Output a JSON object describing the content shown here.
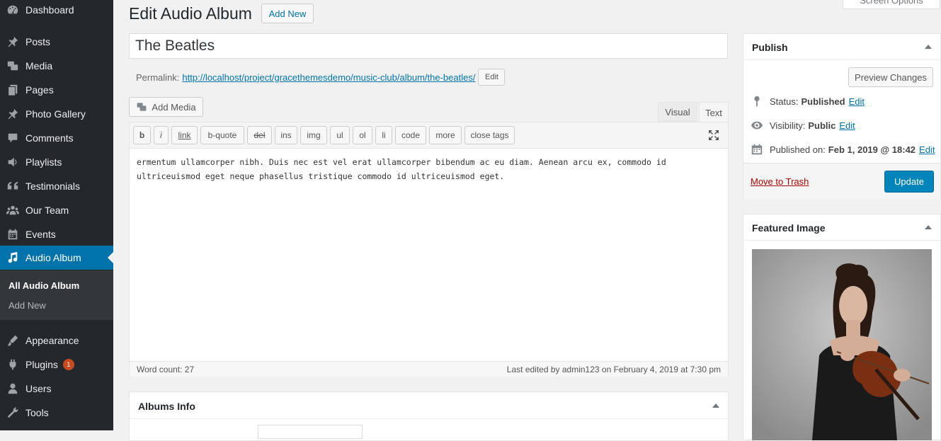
{
  "sidebar": {
    "items": [
      {
        "label": "Dashboard",
        "icon": "dashboard-icon"
      },
      {
        "label": "Posts",
        "icon": "pin-icon"
      },
      {
        "label": "Media",
        "icon": "media-icon"
      },
      {
        "label": "Pages",
        "icon": "pages-icon"
      },
      {
        "label": "Photo Gallery",
        "icon": "pin-icon"
      },
      {
        "label": "Comments",
        "icon": "comment-icon"
      },
      {
        "label": "Playlists",
        "icon": "speaker-icon"
      },
      {
        "label": "Testimonials",
        "icon": "quote-icon"
      },
      {
        "label": "Our Team",
        "icon": "team-icon"
      },
      {
        "label": "Events",
        "icon": "calendar-icon"
      },
      {
        "label": "Audio Album",
        "icon": "music-icon"
      },
      {
        "label": "Appearance",
        "icon": "appearance-icon"
      },
      {
        "label": "Plugins",
        "icon": "plugin-icon",
        "badge": "1"
      },
      {
        "label": "Users",
        "icon": "user-icon"
      },
      {
        "label": "Tools",
        "icon": "tools-icon"
      }
    ],
    "submenu": [
      {
        "label": "All Audio Album"
      },
      {
        "label": "Add New"
      }
    ]
  },
  "header": {
    "title": "Edit Audio Album",
    "add_new": "Add New",
    "screen_options": "Screen Options"
  },
  "post": {
    "title": "The Beatles",
    "permalink_label": "Permalink:",
    "permalink_base": "http://localhost/project/gracethemesdemo/music-club/album/",
    "permalink_slug": "the-beatles",
    "permalink_tail": "/",
    "permalink_edit": "Edit"
  },
  "editor": {
    "add_media": "Add Media",
    "tab_visual": "Visual",
    "tab_text": "Text",
    "quicktags": [
      "b",
      "i",
      "link",
      "b-quote",
      "del",
      "ins",
      "img",
      "ul",
      "ol",
      "li",
      "code",
      "more",
      "close tags"
    ],
    "content_line1": "ermentum ullamcorper nibh. Duis nec est vel erat ullamcorper bibendum ac eu diam. Aenean arcu ex, commodo id",
    "content_line2": "ultriceuismod eget neque phasellus tristique commodo id ultriceuismod eget.",
    "word_count": "Word count: 27",
    "last_edited": "Last edited by admin123 on February 4, 2019 at 7:30 pm"
  },
  "albums_info": {
    "title": "Albums Info"
  },
  "publish": {
    "title": "Publish",
    "preview": "Preview Changes",
    "status_label": "Status:",
    "status_value": "Published",
    "visibility_label": "Visibility:",
    "visibility_value": "Public",
    "published_label": "Published on:",
    "published_value": "Feb 1, 2019 @ 18:42",
    "edit": "Edit",
    "trash": "Move to Trash",
    "update": "Update"
  },
  "featured": {
    "title": "Featured Image"
  }
}
